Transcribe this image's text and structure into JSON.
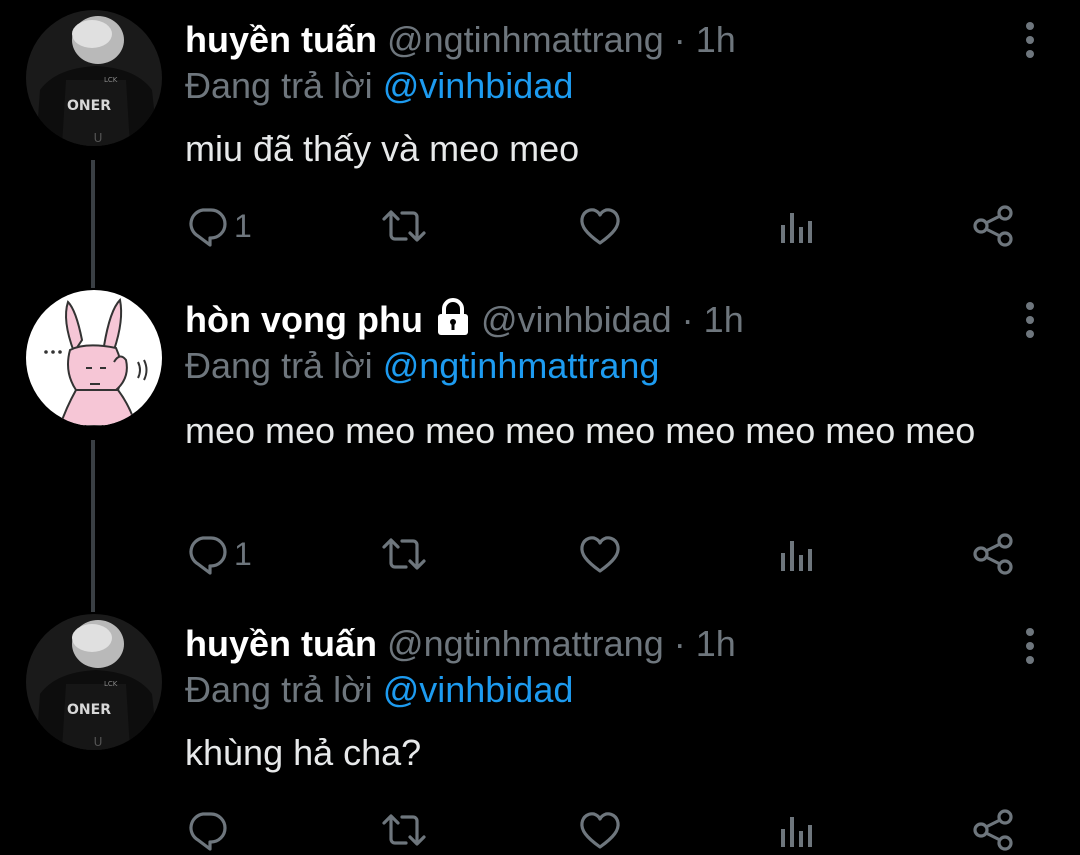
{
  "tweets": [
    {
      "name": "huyền tuấn",
      "handle": "@ngtinhmattrang",
      "dot": "·",
      "time": "1h",
      "reply_prefix": "Đang trả lời",
      "reply_to": "@vinhbidad",
      "text": "miu đã thấy và meo meo",
      "reply_count": "1",
      "avatar": "oner-avatar",
      "avatar_jersey_text": "ONER",
      "locked": false
    },
    {
      "name": "hòn vọng phu",
      "handle": "@vinhbidad",
      "dot": "·",
      "time": "1h",
      "reply_prefix": "Đang trả lời",
      "reply_to": "@ngtinhmattrang",
      "text": "meo meo meo meo meo meo meo meo meo meo",
      "reply_count": "1",
      "avatar": "pink-rabbit-avatar",
      "locked": true
    },
    {
      "name": "huyền tuấn",
      "handle": "@ngtinhmattrang",
      "dot": "·",
      "time": "1h",
      "reply_prefix": "Đang trả lời",
      "reply_to": "@vinhbidad",
      "text": "khùng hả cha?",
      "reply_count": "",
      "avatar": "oner-avatar",
      "avatar_jersey_text": "ONER",
      "locked": false
    }
  ],
  "icons": {
    "reply": "reply-icon",
    "retweet": "retweet-icon",
    "like": "heart-icon",
    "analytics": "analytics-icon",
    "share": "share-icon",
    "more": "more-vertical-icon",
    "lock": "lock-icon"
  },
  "colors": {
    "background": "#000000",
    "muted": "#6e767d",
    "mention": "#1d9bf0",
    "text": "#e7e9ea"
  }
}
